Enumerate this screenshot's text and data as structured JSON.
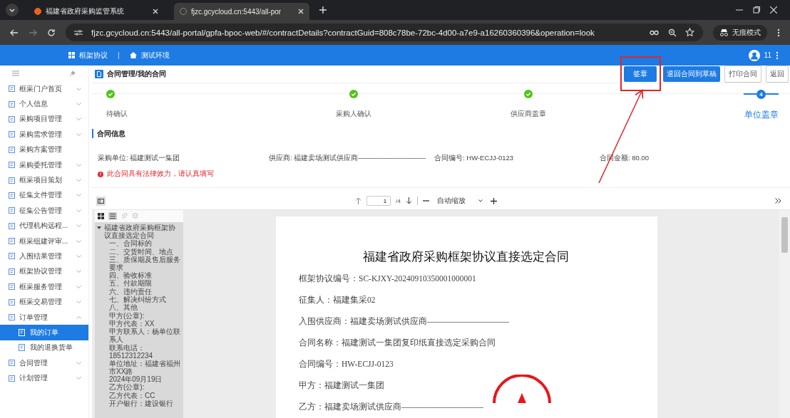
{
  "browser": {
    "tabs": [
      {
        "title": "福建省政府采购监管系统",
        "selected": false
      },
      {
        "title": "fjzc.gcycloud.cn:5443/all-por",
        "selected": true
      }
    ],
    "address": "fjzc.gcycloud.cn:5443/all-portal/gpfa-bpoc-web/#/contractDetails?contractGuid=808c78be-72bc-4d00-a7e9-a16260360396&operation=look",
    "incognito_label": "无痕模式"
  },
  "app_bar": {
    "system": "框架协议",
    "separator": "|",
    "environment": "测试环境",
    "user_badge": "11"
  },
  "sidebar": {
    "items": [
      {
        "label": "框采门户首页",
        "expanded": false,
        "selected": false
      },
      {
        "label": "个人信息",
        "expanded": false,
        "selected": false
      },
      {
        "label": "采购项目管理",
        "expanded": false,
        "selected": false
      },
      {
        "label": "采购需求管理",
        "expanded": false,
        "selected": false
      },
      {
        "label": "采购方案管理",
        "selected": false
      },
      {
        "label": "采购委托管理",
        "expanded": false,
        "selected": false
      },
      {
        "label": "框采项目策划",
        "expanded": false,
        "selected": false
      },
      {
        "label": "征集文件管理",
        "expanded": false,
        "selected": false
      },
      {
        "label": "征集公告管理",
        "expanded": false,
        "selected": false
      },
      {
        "label": "代理机构远程...",
        "expanded": false,
        "selected": false
      },
      {
        "label": "框采组建评审...",
        "expanded": false,
        "selected": false
      },
      {
        "label": "入围结果管理",
        "expanded": false,
        "selected": false
      },
      {
        "label": "框架协议管理",
        "expanded": false,
        "selected": false
      },
      {
        "label": "框采服务管理",
        "expanded": false,
        "selected": false
      },
      {
        "label": "框采交易管理",
        "expanded": false,
        "selected": false
      },
      {
        "label": "订单管理",
        "expanded": true,
        "selected": false,
        "children": [
          {
            "label": "我的订单",
            "selected": true
          },
          {
            "label": "我的退换货单",
            "selected": false
          }
        ]
      },
      {
        "label": "合同管理",
        "expanded": false,
        "selected": false
      },
      {
        "label": "计划管理",
        "expanded": false,
        "selected": false
      }
    ]
  },
  "header": {
    "breadcrumb": "合同管理/我的合同",
    "buttons": [
      {
        "label": "签章",
        "kind": "primary"
      },
      {
        "label": "退回合同到草稿",
        "kind": "primary"
      },
      {
        "label": "打印合同",
        "kind": "outline"
      },
      {
        "label": "返回",
        "kind": "outline"
      }
    ]
  },
  "steps": [
    {
      "label": "待确认",
      "completed": true
    },
    {
      "label": "采购人确认",
      "completed": true
    },
    {
      "label": "供应商盖章",
      "completed": true
    },
    {
      "label": "单位盖章",
      "completed": false,
      "number": "4"
    }
  ],
  "contract_info": {
    "title": "合同信息",
    "fields": [
      "采购单位: 福建测试一集团",
      "供应商: 福建卖场测试供应商——————————",
      "合同编号: HW-ECJJ-0123",
      "合同金额: 80.00"
    ],
    "warning": "此合同具有法律效力，请认真填写"
  },
  "viewer": {
    "page": "1",
    "page_count": "/4",
    "zoom": "自动缩放",
    "outline": [
      {
        "label": "福建省政府采购框架协议直接选定合同",
        "expanded": true,
        "children": [
          {
            "label": "一、合同标的"
          },
          {
            "label": "二、交货时间、地点"
          },
          {
            "label": "三、质保期及售后服务要求"
          },
          {
            "label": "四、验收标准"
          },
          {
            "label": "五、付款期限"
          },
          {
            "label": "六、违约责任"
          },
          {
            "label": "七、解决纠纷方式"
          },
          {
            "label": "八、其他"
          },
          {
            "label": "甲方(公章):"
          },
          {
            "label": "甲方代表：XX"
          },
          {
            "label": "甲方联系人：杨单位联系人"
          },
          {
            "label": "联系电话：18512312234"
          },
          {
            "label": "单位地址：福建省福州市XX路"
          },
          {
            "label": "2024年09月19日"
          },
          {
            "label": "乙方(公章):"
          },
          {
            "label": "乙方代表：CC"
          },
          {
            "label": "开户银行：建设银行"
          }
        ]
      }
    ],
    "document": {
      "title": "福建省政府采购框架协议直接选定合同",
      "lines": [
        "框架协议编号：SC-KJXY-20240910350001000001",
        "征集人：福建集采02",
        "入围供应商：福建卖场测试供应商——————————",
        "合同名称：福建测试一集团复印纸直接选定采购合同",
        "合同编号：HW-ECJJ-0123",
        "甲方：福建测试一集团",
        "乙方：福建卖场测试供应商——————————"
      ]
    }
  }
}
